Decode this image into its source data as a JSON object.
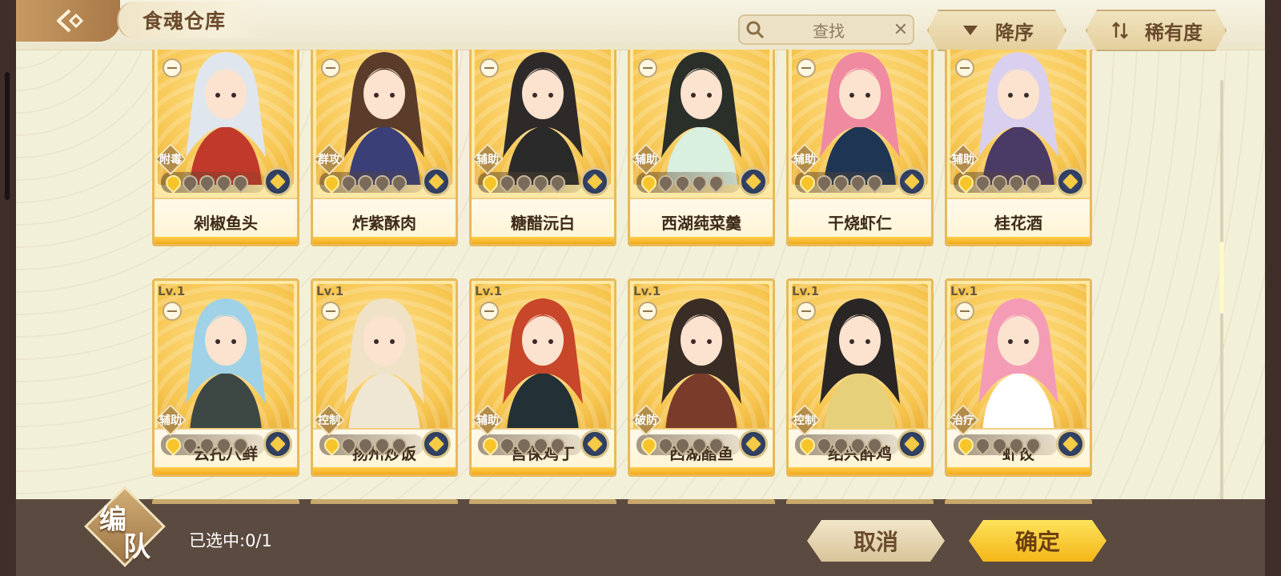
{
  "header": {
    "title": "食魂仓库",
    "search_text": "查找",
    "sort_label": "降序",
    "filter_label": "稀有度"
  },
  "cards": [
    {
      "name": "剁椒鱼头",
      "role": "附毒",
      "level": "",
      "stars": 1
    },
    {
      "name": "炸紫酥肉",
      "role": "群攻",
      "level": "",
      "stars": 1
    },
    {
      "name": "糖醋沅白",
      "role": "辅助",
      "level": "",
      "stars": 1
    },
    {
      "name": "西湖莼菜羹",
      "role": "辅助",
      "level": "",
      "stars": 1
    },
    {
      "name": "干烧虾仁",
      "role": "辅助",
      "level": "",
      "stars": 1
    },
    {
      "name": "桂花酒",
      "role": "辅助",
      "level": "",
      "stars": 1
    },
    {
      "name": "云托八鲜",
      "role": "辅助",
      "level": "Lv.1",
      "stars": 1
    },
    {
      "name": "扬州炒饭",
      "role": "控制",
      "level": "Lv.1",
      "stars": 1
    },
    {
      "name": "宫保鸡丁",
      "role": "辅助",
      "level": "Lv.1",
      "stars": 1
    },
    {
      "name": "西湖醋鱼",
      "role": "破防",
      "level": "Lv.1",
      "stars": 1
    },
    {
      "name": "绍兴醉鸡",
      "role": "控制",
      "level": "Lv.1",
      "stars": 1
    },
    {
      "name": "虾饺",
      "role": "治疗",
      "level": "Lv.1",
      "stars": 1
    }
  ],
  "footer": {
    "team_label_1": "编",
    "team_label_2": "队",
    "selected_text": "已选中:0/1",
    "cancel_label": "取消",
    "confirm_label": "确定"
  },
  "colors": {
    "accent_gold": "#f4b619",
    "brown_text": "#6a4b2c",
    "bottom_bar": "#5a4a3f"
  },
  "icons": [
    "back-arrow-icon",
    "search-icon",
    "close-icon",
    "sort-descending-icon",
    "rarity-sort-icon",
    "lock-icon",
    "star-icon",
    "element-badge-icon"
  ]
}
